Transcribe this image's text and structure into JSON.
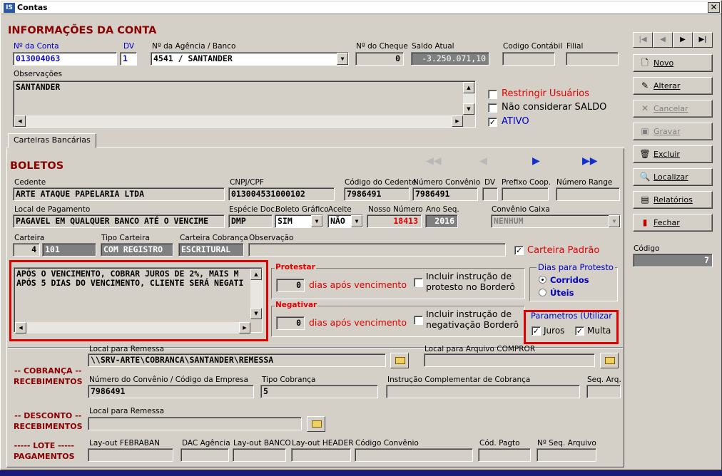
{
  "window": {
    "title": "Contas",
    "close": "✕",
    "icon": "IS"
  },
  "conta": {
    "section": "INFORMAÇÕES DA CONTA",
    "n_conta_label": "Nº da Conta",
    "n_conta": "013004063",
    "dv_label": "DV",
    "dv": "1",
    "agencia_label": "Nº da Agência / Banco",
    "agencia": "4541 / SANTANDER",
    "cheque_label": "Nº do Cheque",
    "cheque": "0",
    "saldo_label": "Saldo Atual",
    "saldo": "-3.250.071,10",
    "contabil_label": "Codigo Contábil",
    "contabil": "",
    "filial_label": "Filial",
    "filial": "",
    "obs_label": "Observações",
    "obs": "SANTANDER",
    "restringir": "Restringir Usuários",
    "nao_saldo": "Não considerar SALDO",
    "ativo": "ATIVO"
  },
  "tab": {
    "label": "Carteiras Bancárias"
  },
  "boletos": {
    "section": "BOLETOS",
    "cedente_label": "Cedente",
    "cedente": "ARTE ATAQUE PAPELARIA LTDA",
    "cnpj_label": "CNPJ/CPF",
    "cnpj": "013004531000102",
    "cod_cedente_label": "Código do Cedente",
    "cod_cedente": "7986491",
    "num_convenio_label": "Número Convênio",
    "num_convenio": "7986491",
    "dv_label": "DV",
    "dv": "",
    "prefixo_label": "Prefixo Coop.",
    "prefixo": "",
    "num_range_label": "Número Range",
    "num_range": "",
    "local_pag_label": "Local de Pagamento",
    "local_pag": "PAGAVEL EM QUALQUER BANCO ATÉ O VENCIME",
    "especie_label": "Espécie Doc.",
    "especie": "DMP",
    "boleto_graf_label": "Boleto Gráfico",
    "boleto_graf": "SIM",
    "aceite_label": "Aceite",
    "aceite": "NÃO",
    "nosso_num_label": "Nosso Número",
    "nosso_num": "18413",
    "ano_seq_label": "Ano Seq.",
    "ano_seq": "2016",
    "conv_caixa_label": "Convênio Caixa",
    "conv_caixa": "NENHUM",
    "carteira_label": "Carteira",
    "carteira_num": "4",
    "carteira_cod": "101",
    "tipo_label": "Tipo Carteira",
    "tipo": "COM REGISTRO",
    "cobranca_label": "Carteira Cobrança",
    "cobranca": "ESCRITURAL",
    "obs_label": "Observação",
    "obs": "",
    "padrao": "Carteira Padrão",
    "instrucoes": "APÓS O VENCIMENTO, COBRAR JUROS DE 2%, MAIS M\nAPÓS 5 DIAS DO VENCIMENTO, CLIENTE SERÁ NEGATI",
    "protestar_label": "Protestar",
    "protestar_dias": "0",
    "dias_apos": "dias após vencimento",
    "incl_protesto": "Incluir instrução de\nprotesto no Borderô",
    "negativar_label": "Negativar",
    "negativar_dias": "0",
    "incl_negat": "Incluir instrução de\nnegativação Borderô",
    "dias_protesto_label": "Dias para Protesto",
    "corridos": "Corridos",
    "uteis": "Úteis",
    "parametros_label": "Parametros (Utilizar",
    "juros": "Juros",
    "multa": "Multa"
  },
  "cobranca": {
    "group": "-- COBRANÇA --\nRECEBIMENTOS",
    "local_remessa_label": "Local para Remessa",
    "local_remessa": "\\\\SRV-ARTE\\COBRANCA\\SANTANDER\\REMESSA",
    "local_comprob_label": "Local para Arquivo COMPROR",
    "local_comprob": "",
    "convenio_label": "Número do Convênio / Código da Empresa",
    "convenio": "7986491",
    "tipo_cob_label": "Tipo Cobrança",
    "tipo_cob": "5",
    "instr_comp_label": "Instrução Complementar de Cobrança",
    "instr_comp": "",
    "seq_arq_label": "Seq. Arq.",
    "seq_arq": ""
  },
  "desconto": {
    "group": "-- DESCONTO --\nRECEBIMENTOS",
    "local_remessa_label": "Local para Remessa",
    "local_remessa": ""
  },
  "lote": {
    "group": "----- LOTE -----\nPAGAMENTOS",
    "febraban_label": "Lay-out FEBRABAN",
    "dac_label": "DAC Agência",
    "banco_label": "Lay-out BANCO",
    "header_label": "Lay-out HEADER",
    "conv_label": "Código Convênio",
    "pagto_label": "Cód. Pagto",
    "seq_label": "Nº Seq. Arquivo"
  },
  "toolbar": {
    "first": "|◀",
    "prev": "◀",
    "next": "▶",
    "last": "▶|",
    "novo": "Novo",
    "alterar": "Alterar",
    "cancelar": "Cancelar",
    "gravar": "Gravar",
    "excluir": "Excluir",
    "localizar": "Localizar",
    "relatorios": "Relatórios",
    "fechar": "Fechar",
    "codigo_label": "Código",
    "codigo": "7"
  },
  "colors": {
    "accent_red": "#8b0000",
    "highlight": "#e00000",
    "link_blue": "#0000c0"
  }
}
